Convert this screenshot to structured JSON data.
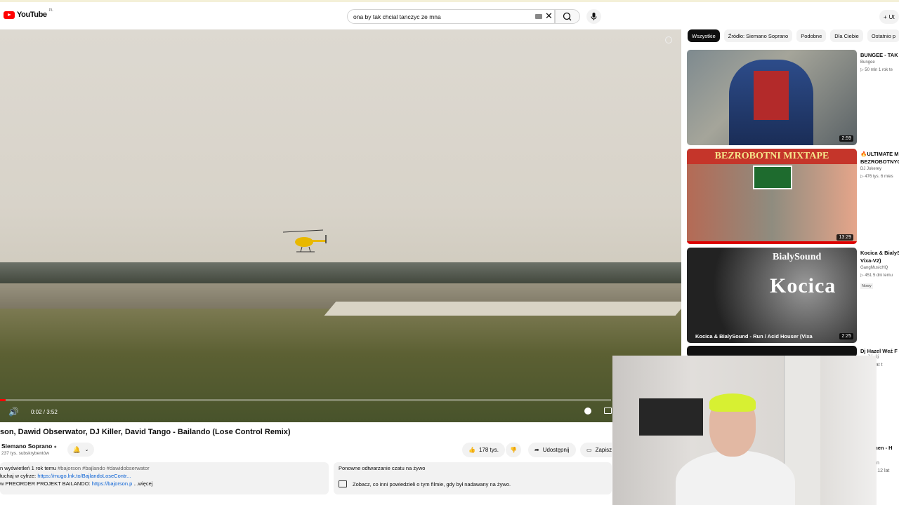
{
  "header": {
    "logo_text": "YouTube",
    "logo_region": "PL",
    "search_value": "ona by tak chcial tanczyc ze mna",
    "create_label": "Ut"
  },
  "player": {
    "time": "0:02 / 3:52",
    "progress_fraction": 0.009
  },
  "video": {
    "title": "son, Dawid Obserwator, DJ Killer, David Tango - Bailando (Lose Control Remix)",
    "channel": "Siemano Soprano",
    "subscribers": "237 tys. subskrybentów",
    "likes": "178 tys.",
    "share_label": "Udostępnij",
    "save_label": "Zapisz"
  },
  "description": {
    "line1_views": "n wyświetleń  1 rok temu",
    "line1_tags": "#bajorson #bajlando #dawidobserwator",
    "line2_prefix": "łuchaj w cyfrze: ",
    "line2_link": "https://mugo.lnk.to/BajlandoLoseContr...",
    "line3_prefix": "w PREORDER PROJEKT BAILANDO: ",
    "line3_link": "https://bajorson.p",
    "line3_more": "...więcej"
  },
  "chat": {
    "title": "Ponowne odtwarzanie czatu na żywo",
    "subtitle": "Zobacz, co inni powiedzieli o tym filmie, gdy był nadawany na żywo."
  },
  "chips": [
    "Wszystkie",
    "Źródło: Siemano Soprano",
    "Podobne",
    "Dla Ciebie",
    "Ostatnio p"
  ],
  "recommendations": [
    {
      "title": "BUNGEE - TAK T",
      "channel": "Bungee",
      "stats": "▷ 50 mln  1 rok te",
      "duration": "2:59",
      "new": ""
    },
    {
      "title": "🔥ULTIMATE M",
      "title2": "BEZROBOTNYC",
      "channel": "DJ Jokerey",
      "stats": "▷ 476 tys.  6 mies",
      "duration": "13:29",
      "new": "",
      "thumb_text": "BEZROBOTNI MIXTAPE"
    },
    {
      "title": "Kocica & BialyS",
      "title2": "Vixa-V2)",
      "channel": "GangMusicHQ",
      "stats": "▷ 451  5 dni temu",
      "duration": "2:25",
      "new": "Nowy",
      "thumb_text": "Kocica",
      "thumb_brand": "BialySound",
      "thumb_caption": "Kocica & BialySound -  Run / Acid Houser  (Vixa"
    },
    {
      "title": "Dj Hazel  Weź F"
    }
  ],
  "right_edge": {
    "line1": "ilński",
    "line2": "11 lat t",
    "line3": "armen - H",
    "line4": "rmen",
    "line5": "mln  12 lat"
  }
}
